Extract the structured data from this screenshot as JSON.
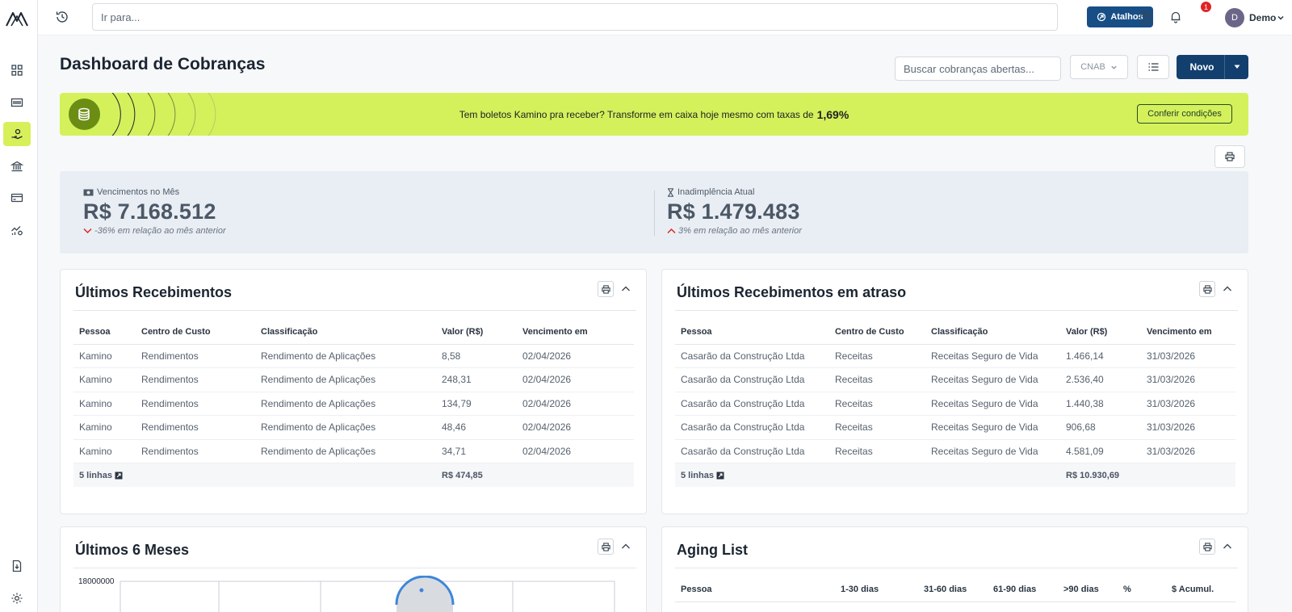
{
  "topbar": {
    "goto_placeholder": "Ir para...",
    "shortcuts_label": "Atalhos",
    "notification_count": "1",
    "user_initial": "D",
    "user_name": "Demo"
  },
  "header": {
    "title": "Dashboard de Cobranças",
    "search_placeholder": "Buscar cobranças abertas...",
    "cnab_label": "CNAB",
    "new_label": "Novo"
  },
  "promo": {
    "text": "Tem boletos Kamino pra receber? Transforme em caixa hoje mesmo com taxas de",
    "rate": "1,69%",
    "cta": "Conferir condições"
  },
  "kpis": [
    {
      "label": "Vencimentos no Mês",
      "value": "R$ 7.168.512",
      "trend": "-36% em relação ao mês anterior",
      "direction": "down"
    },
    {
      "label": "Inadimplência Atual",
      "value": "R$ 1.479.483",
      "trend": "3% em relação ao mês anterior",
      "direction": "up"
    }
  ],
  "recent": {
    "title": "Últimos Recebimentos",
    "columns": [
      "Pessoa",
      "Centro de Custo",
      "Classificação",
      "Valor (R$)",
      "Vencimento em"
    ],
    "rows": [
      [
        "Kamino",
        "Rendimentos",
        "Rendimento de Aplicações",
        "8,58",
        "02/04/2026"
      ],
      [
        "Kamino",
        "Rendimentos",
        "Rendimento de Aplicações",
        "248,31",
        "02/04/2026"
      ],
      [
        "Kamino",
        "Rendimentos",
        "Rendimento de Aplicações",
        "134,79",
        "02/04/2026"
      ],
      [
        "Kamino",
        "Rendimentos",
        "Rendimento de Aplicações",
        "48,46",
        "02/04/2026"
      ],
      [
        "Kamino",
        "Rendimentos",
        "Rendimento de Aplicações",
        "34,71",
        "02/04/2026"
      ]
    ],
    "footer_lines": "5 linhas",
    "footer_total": "R$ 474,85"
  },
  "overdue": {
    "title": "Últimos Recebimentos em atraso",
    "columns": [
      "Pessoa",
      "Centro de Custo",
      "Classificação",
      "Valor (R$)",
      "Vencimento em"
    ],
    "rows": [
      [
        "Casarão da Construção Ltda",
        "Receitas",
        "Receitas Seguro de Vida",
        "1.466,14",
        "31/03/2026"
      ],
      [
        "Casarão da Construção Ltda",
        "Receitas",
        "Receitas Seguro de Vida",
        "2.536,40",
        "31/03/2026"
      ],
      [
        "Casarão da Construção Ltda",
        "Receitas",
        "Receitas Seguro de Vida",
        "1.440,38",
        "31/03/2026"
      ],
      [
        "Casarão da Construção Ltda",
        "Receitas",
        "Receitas Seguro de Vida",
        "906,68",
        "31/03/2026"
      ],
      [
        "Casarão da Construção Ltda",
        "Receitas",
        "Receitas Seguro de Vida",
        "4.581,09",
        "31/03/2026"
      ]
    ],
    "footer_lines": "5 linhas",
    "footer_total": "R$ 10.930,69"
  },
  "months": {
    "title": "Últimos 6 Meses",
    "y_top_label": "18000000"
  },
  "aging": {
    "title": "Aging List",
    "columns": [
      "Pessoa",
      "1-30 dias",
      "31-60 dias",
      "61-90 dias",
      ">90 dias",
      "%",
      "$ Acumul."
    ]
  },
  "colors": {
    "accent": "#184e86",
    "promo_bg": "#d4f15c",
    "sidebar_active": "#d7f05a",
    "kpi_bg": "#e9eef5",
    "trend_down": "#d9281e",
    "trend_up": "#d9281e"
  },
  "icons": [
    "logo-icon",
    "history-icon",
    "help-icon",
    "bell-icon",
    "chevron-down-icon",
    "print-icon",
    "chevron-up-icon",
    "list-icon",
    "coins-icon",
    "hourglass-icon",
    "money-icon"
  ]
}
